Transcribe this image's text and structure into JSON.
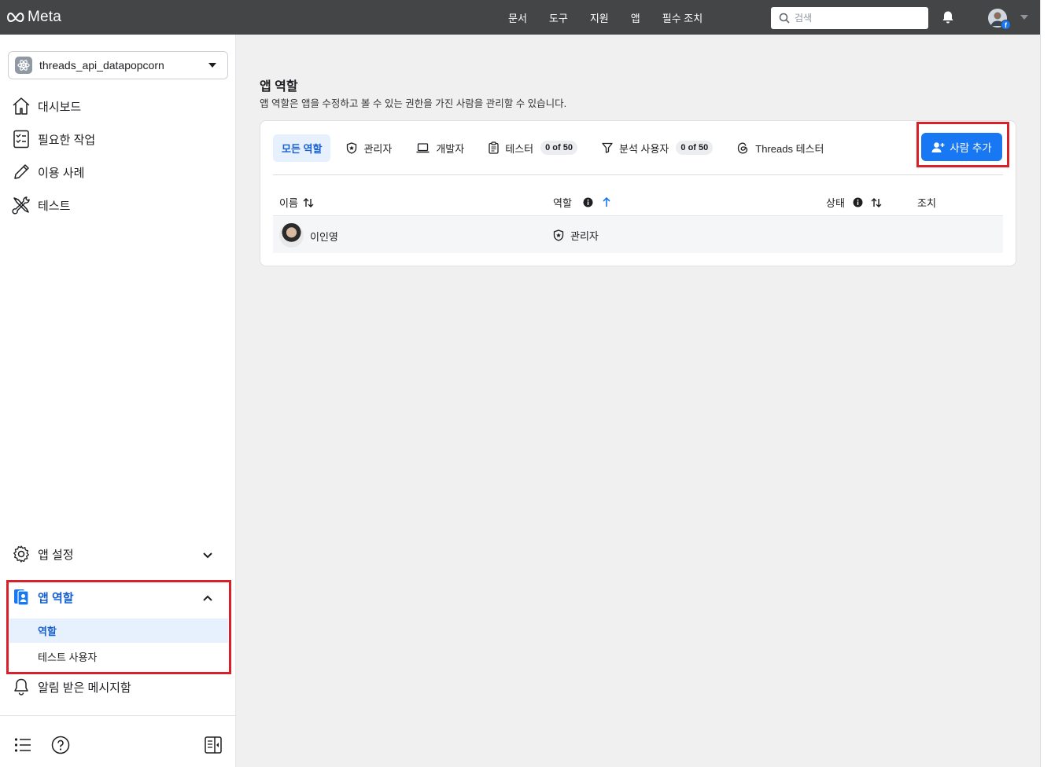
{
  "topbar": {
    "brand": "Meta",
    "nav": [
      "문서",
      "도구",
      "지원",
      "앱",
      "필수 조치"
    ],
    "search_placeholder": "검색"
  },
  "sidebar": {
    "app_name": "threads_api_datapopcorn",
    "items": [
      {
        "label": "대시보드",
        "icon": "home-icon"
      },
      {
        "label": "필요한 작업",
        "icon": "checklist-icon"
      },
      {
        "label": "이용 사례",
        "icon": "pencil-icon"
      },
      {
        "label": "테스트",
        "icon": "tools-icon"
      }
    ],
    "app_settings": "앱 설정",
    "app_roles": "앱 역할",
    "app_roles_sub": [
      "역할",
      "테스트 사용자"
    ],
    "notifications": "알림 받은 메시지함"
  },
  "main": {
    "title": "앱 역할",
    "description": "앱 역할은 앱을 수정하고 볼 수 있는 권한을 가진 사람을 관리할 수 있습니다.",
    "tabs": [
      {
        "label": "모든 역할",
        "active": true
      },
      {
        "label": "관리자",
        "icon": "shield-star-icon"
      },
      {
        "label": "개발자",
        "icon": "laptop-icon"
      },
      {
        "label": "테스터",
        "icon": "clipboard-icon",
        "count": "0 of 50"
      },
      {
        "label": "분석 사용자",
        "icon": "filter-icon",
        "count": "0 of 50"
      },
      {
        "label": "Threads 테스터",
        "icon": "threads-icon"
      }
    ],
    "add_button": "사람 추가",
    "columns": {
      "name": "이름",
      "role": "역할",
      "status": "상태",
      "actions": "조치"
    },
    "rows": [
      {
        "name": "이인영",
        "role": "관리자"
      }
    ]
  },
  "colors": {
    "accent": "#1877f2",
    "highlight": "#d8202a",
    "topbar": "#444547"
  }
}
